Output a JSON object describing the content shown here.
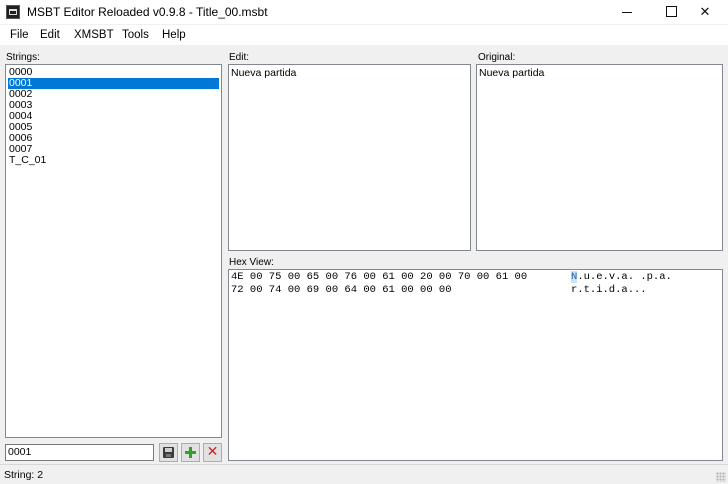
{
  "window": {
    "title": "MSBT Editor Reloaded v0.9.8 - Title_00.msbt",
    "minimize_label": "",
    "maximize_label": "",
    "close_label": "✕"
  },
  "menu": [
    "File",
    "Edit",
    "XMSBT",
    "Tools",
    "Help"
  ],
  "strings_panel": {
    "label": "Strings:",
    "items": [
      "0000",
      "0001",
      "0002",
      "0003",
      "0004",
      "0005",
      "0006",
      "0007",
      "T_C_01"
    ],
    "selected_index": 1
  },
  "edit_panel": {
    "label": "Edit:",
    "text": "Nueva partida"
  },
  "original_panel": {
    "label": "Original:",
    "text": "Nueva partida"
  },
  "hex_view": {
    "label": "Hex View:",
    "hex_lines": [
      "4E 00 75 00 65 00 76 00 61 00 20 00 70 00 61 00",
      "72 00 74 00 69 00 64 00 61 00 00 00"
    ],
    "ascii_lines": [
      {
        "first": "N",
        "rest": ".u.e.v.a. .p.a."
      },
      {
        "first": "",
        "rest": "r.t.i.d.a..."
      }
    ]
  },
  "bottom_toolbar": {
    "name_value": "0001",
    "icons": [
      "save-icon",
      "add-icon",
      "delete-icon"
    ]
  },
  "status": {
    "text": "String: 2"
  }
}
